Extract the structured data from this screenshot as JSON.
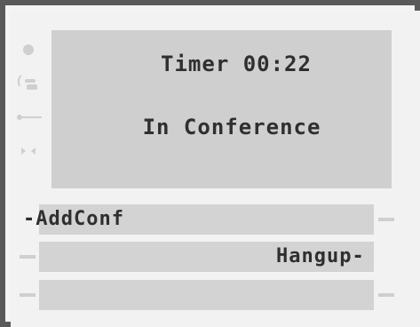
{
  "screen": {
    "timer_text": "Timer 00:22",
    "status_text": "In Conference"
  },
  "softkeys": {
    "left_1_label": "-AddConf",
    "right_2_label": "Hangup-",
    "left_3_label": ""
  },
  "icons": {
    "status_1": "status-led-icon",
    "status_2": "handset-icon",
    "status_3": "key-icon",
    "status_4": "bowtie-icon"
  },
  "colors": {
    "frame": "#5a5a5a",
    "screen_bg": "#cfcfcf",
    "text": "#2f2f2f",
    "softkey_bg": "#d3d3d3"
  }
}
